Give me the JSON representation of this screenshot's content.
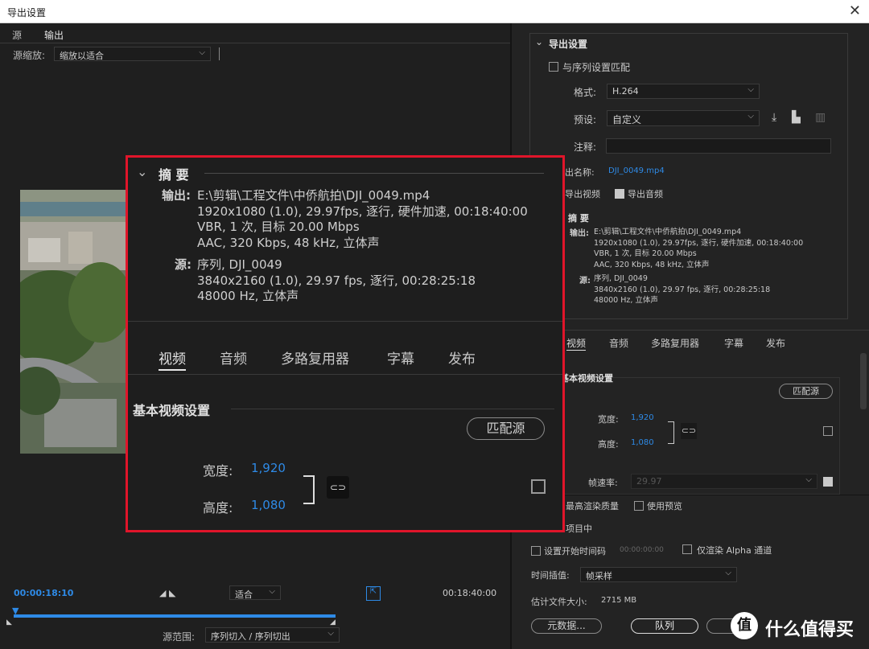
{
  "window": {
    "title": "导出设置",
    "close_glyph": "✕"
  },
  "left": {
    "tabs": [
      "源",
      "输出"
    ],
    "source_scale_label": "源缩放:",
    "source_scale_value": "缩放以适合",
    "timecode_in": "00:00:18:10",
    "timecode_out": "00:18:40:00",
    "fit_value": "适合",
    "source_range_label": "源范围:",
    "source_range_value": "序列切入 / 序列切出"
  },
  "export_settings": {
    "section_title": "导出设置",
    "match_sequence": "与序列设置匹配",
    "format_label": "格式:",
    "format_value": "H.264",
    "preset_label": "预设:",
    "preset_value": "自定义",
    "comment_label": "注释:",
    "output_name_label": "出名称:",
    "output_name_value": "DJI_0049.mp4",
    "export_video": "导出视频",
    "export_audio": "导出音频"
  },
  "summary": {
    "title": "摘 要",
    "output_label": "输出:",
    "output_lines": [
      "E:\\剪辑\\工程文件\\中侨航拍\\DJI_0049.mp4",
      "1920x1080 (1.0), 29.97fps, 逐行, 硬件加速, 00:18:40:00",
      "VBR, 1 次, 目标 20.00 Mbps",
      "AAC, 320 Kbps, 48 kHz, 立体声"
    ],
    "source_label": "源:",
    "source_lines": [
      "序列, DJI_0049",
      "3840x2160 (1.0), 29.97 fps, 逐行, 00:28:25:18",
      "48000 Hz, 立体声"
    ]
  },
  "tabs": [
    "视频",
    "音频",
    "多路复用器",
    "字幕",
    "发布"
  ],
  "video": {
    "section_title": "基本视频设置",
    "match_source": "匹配源",
    "width_label": "宽度:",
    "width_value": "1,920",
    "height_label": "高度:",
    "height_value": "1,080",
    "frame_rate_label": "帧速率:",
    "frame_rate_value": "29.97"
  },
  "bottom": {
    "max_render_quality": "最高渲染质量",
    "use_preview": "使用预览",
    "import_into_project": "项目中",
    "set_start_timecode": "设置开始时间码",
    "start_timecode_value": "00:00:00:00",
    "render_alpha": "仅渲染 Alpha 通道",
    "interpolation_label": "时间插值:",
    "interpolation_value": "帧采样",
    "estimated_size_label": "估计文件大小:",
    "estimated_size_value": "2715 MB",
    "metadata_button": "元数据...",
    "queue_button": "队列"
  },
  "watermark": {
    "text": "什么值得买",
    "badge": "值"
  },
  "colors": {
    "accent_blue": "#2e8ae6",
    "highlight_red": "#e0152a"
  }
}
